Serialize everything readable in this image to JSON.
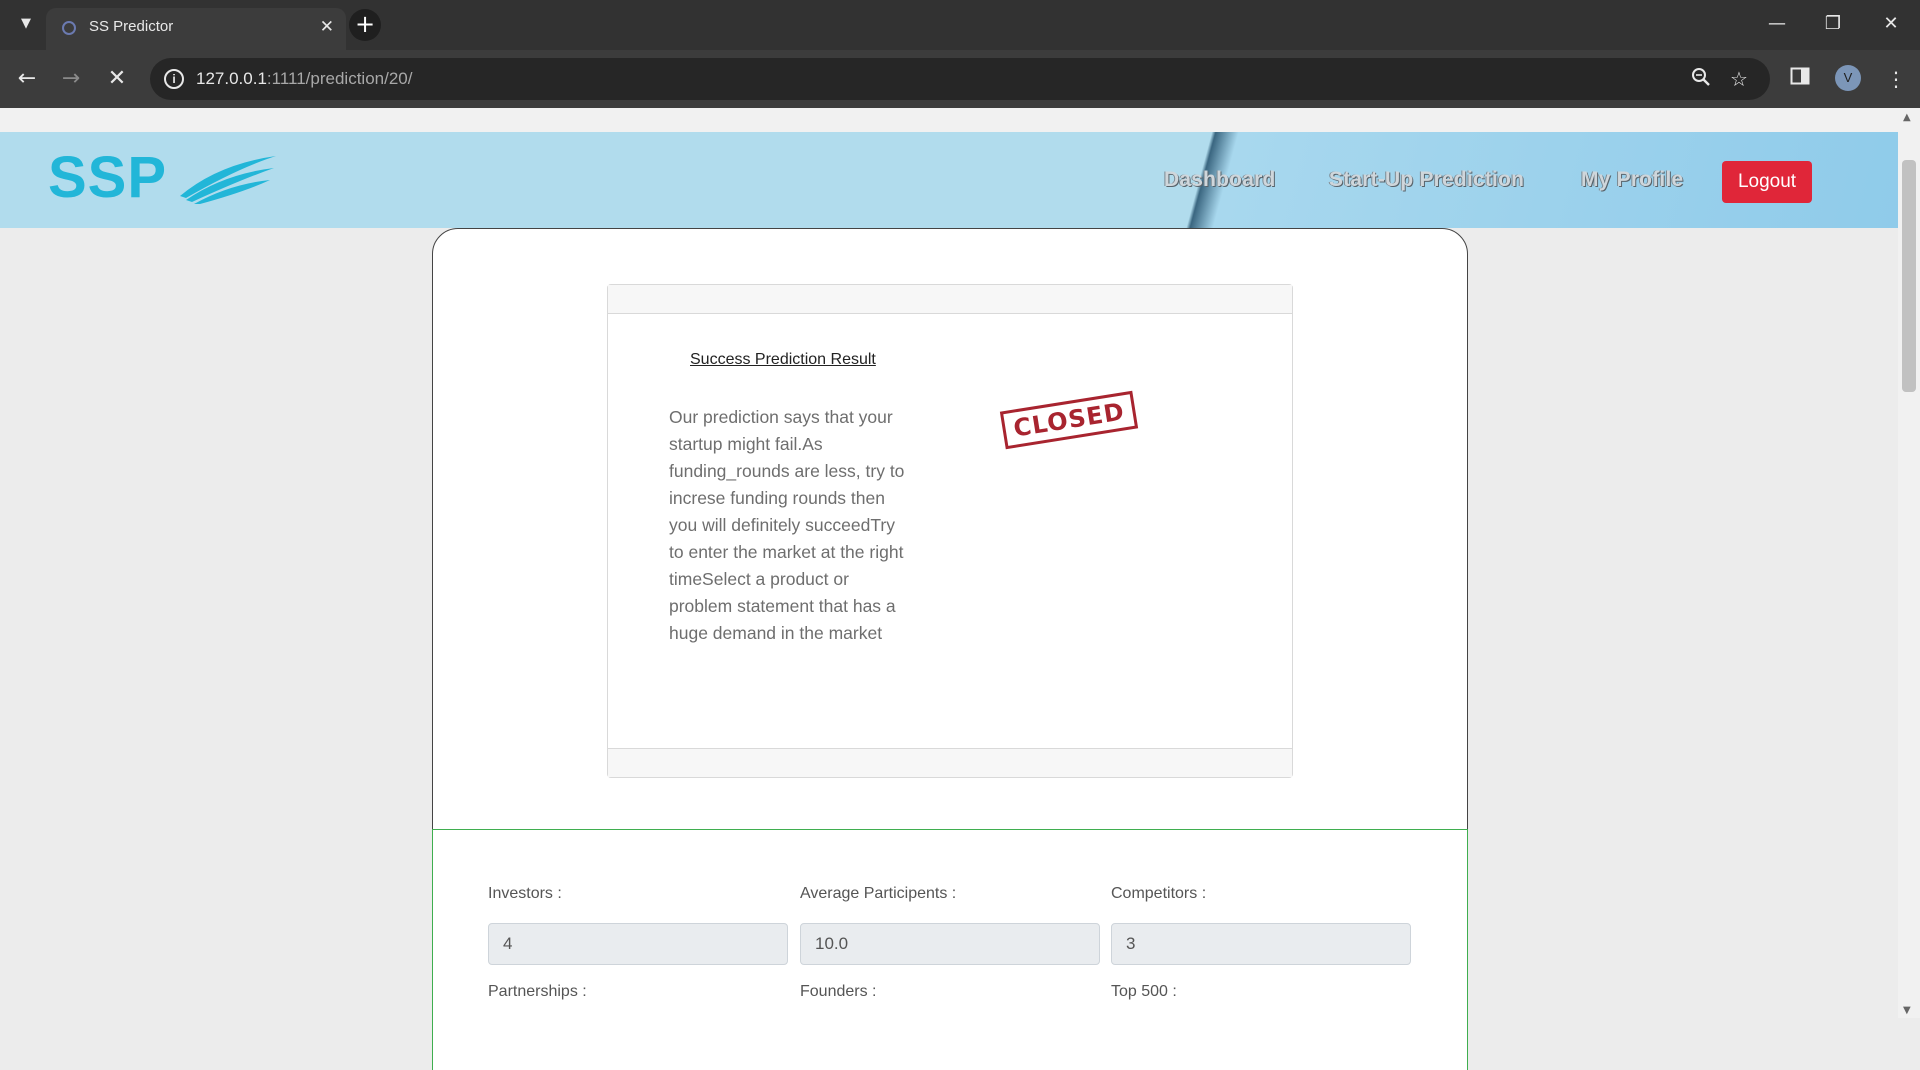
{
  "browser": {
    "tab_title": "SS Predictor",
    "url_host": "127.0.0.1",
    "url_rest": ":1111/prediction/20/",
    "profile_initial": "V"
  },
  "site": {
    "logo": "SSP",
    "nav": [
      "Dashboard",
      "Start-Up Prediction",
      "My Profile"
    ],
    "logout_label": "Logout",
    "colors": {
      "header": "#b1dced",
      "logo": "#22b6d8",
      "logout": "#e02639",
      "stamp": "#a8242f"
    }
  },
  "result": {
    "title": "Success Prediction Result",
    "message": "Our prediction says that your startup might fail.As funding_rounds are less, try to increse funding rounds then you will definitely succeedTry to enter the market at the right timeSelect a product or problem statement that has a huge demand in the market",
    "stamp": "CLOSED"
  },
  "details": {
    "fields": [
      {
        "label": "Investors :",
        "value": "4"
      },
      {
        "label": "Average Participents :",
        "value": "10.0"
      },
      {
        "label": "Competitors :",
        "value": "3"
      }
    ],
    "next_labels": [
      "Partnerships :",
      "Founders :",
      "Top 500 :"
    ]
  }
}
